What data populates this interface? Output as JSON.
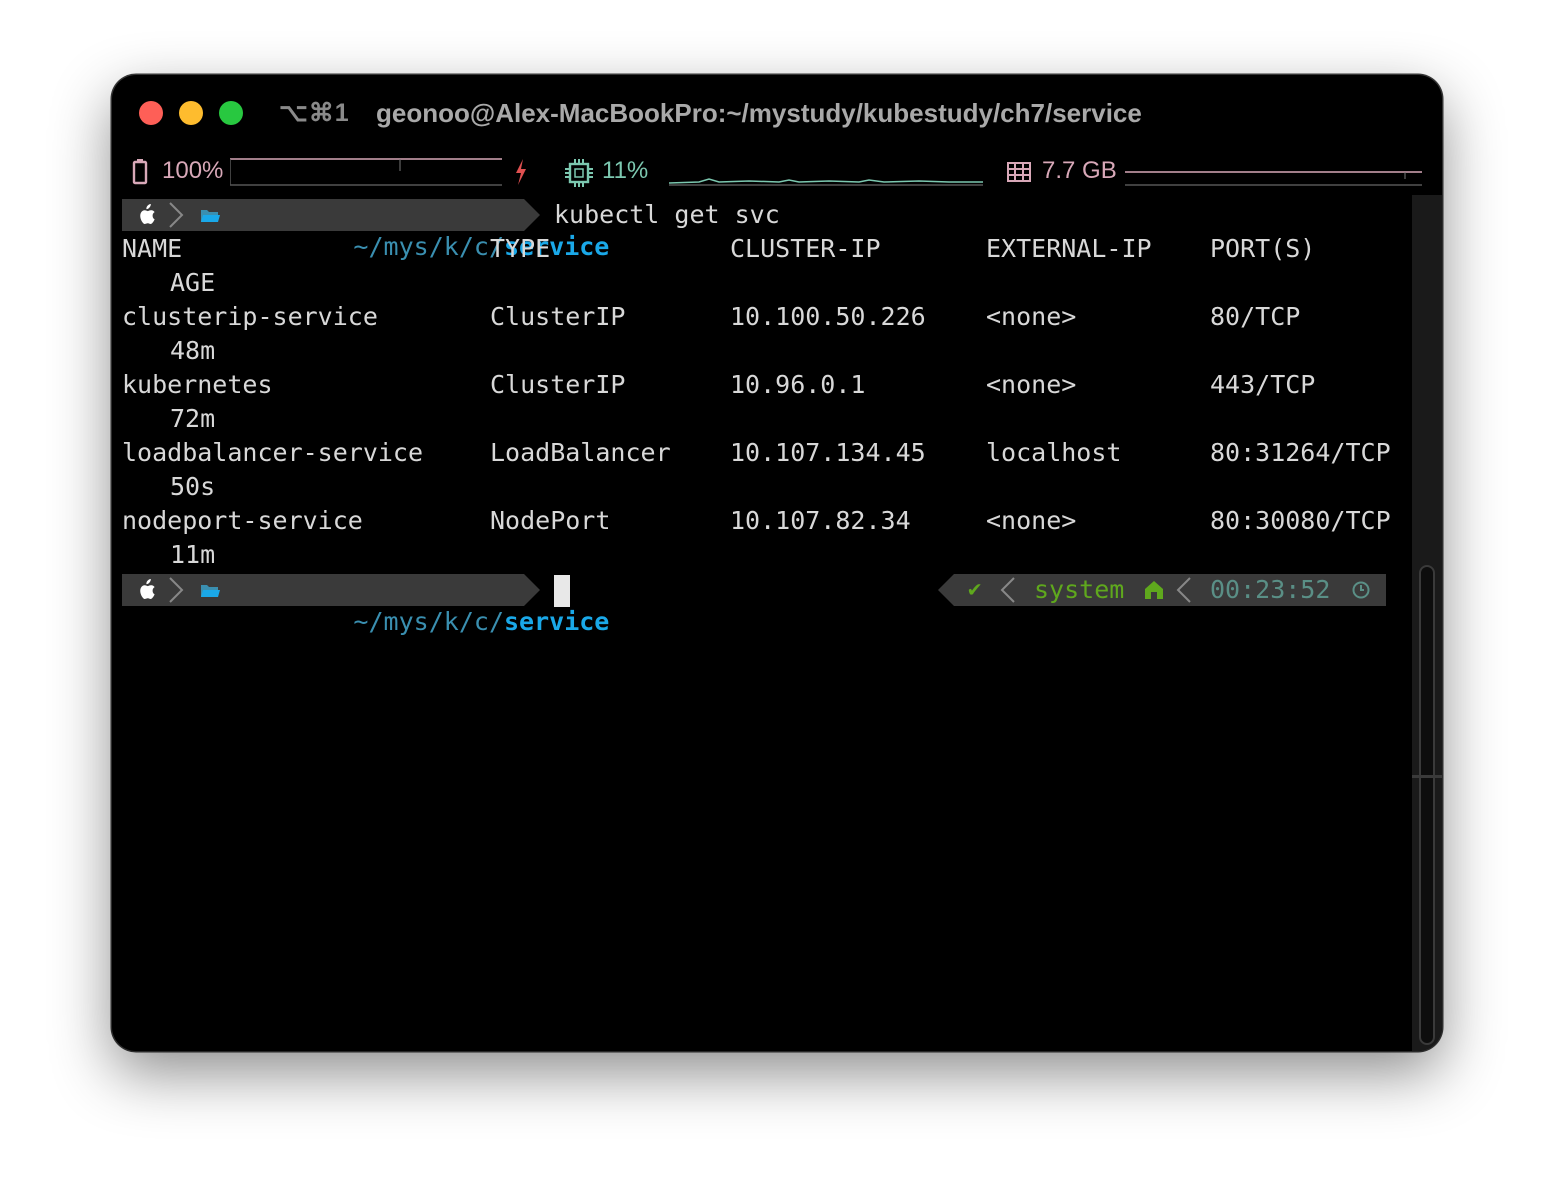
{
  "window": {
    "shortcut": "⌥⌘1",
    "title": "geonoo@Alex-MacBookPro:~/mystudy/kubestudy/ch7/service"
  },
  "statusbar": {
    "battery": "100%",
    "cpu": "11%",
    "memory": "7.7 GB"
  },
  "prompt": {
    "path_prefix": "~/",
    "path_seg1": "mys",
    "path_seg2": "k",
    "path_seg3": "c",
    "path_current": "service",
    "sep": "/"
  },
  "command": "kubectl get svc",
  "table": {
    "headers": [
      "NAME",
      "TYPE",
      "CLUSTER-IP",
      "EXTERNAL-IP",
      "PORT(S)"
    ],
    "age_header": "AGE",
    "rows": [
      {
        "name": "clusterip-service",
        "type": "ClusterIP",
        "ip": "10.100.50.226",
        "ext": "<none>",
        "ports": "80/TCP",
        "age": "48m"
      },
      {
        "name": "kubernetes",
        "type": "ClusterIP",
        "ip": "10.96.0.1",
        "ext": "<none>",
        "ports": "443/TCP",
        "age": "72m"
      },
      {
        "name": "loadbalancer-service",
        "type": "LoadBalancer",
        "ip": "10.107.134.45",
        "ext": "localhost",
        "ports": "80:31264/TCP",
        "age": "50s"
      },
      {
        "name": "nodeport-service",
        "type": "NodePort",
        "ip": "10.107.82.34",
        "ext": "<none>",
        "ports": "80:30080/TCP",
        "age": "11m"
      }
    ]
  },
  "rprompt": {
    "status": "✔",
    "context": "system",
    "time": "00:23:52"
  },
  "colors": {
    "path_dim": "#3a8fb0",
    "path_bright": "#1aa8e8",
    "green": "#5fa81d",
    "time": "#5a8f86",
    "pink": "#d8a8b8",
    "teal": "#7cc8b0"
  }
}
